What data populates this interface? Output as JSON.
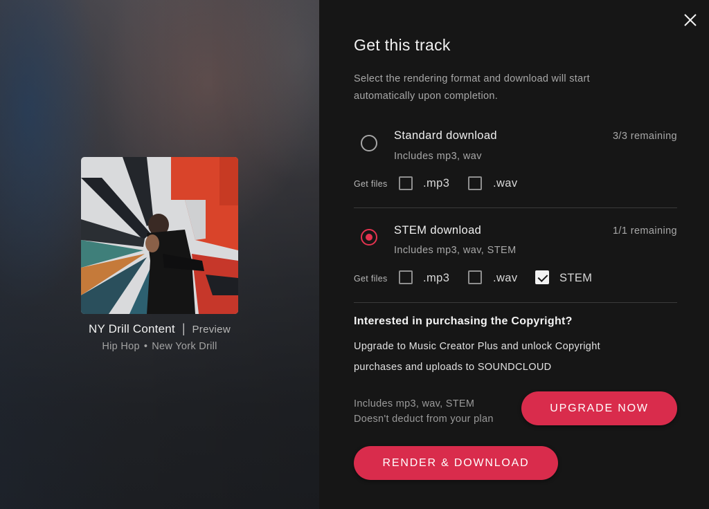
{
  "track": {
    "title": "NY Drill Content",
    "separator": "|",
    "preview_label": "Preview",
    "genres": [
      "Hip Hop",
      "New York Drill"
    ],
    "genre_separator": "•"
  },
  "panel": {
    "heading": "Get this track",
    "intro": "Select the rendering format and download will start automatically upon completion.",
    "close_icon": "close-icon"
  },
  "options": [
    {
      "title": "Standard download",
      "remaining": "3/3 remaining",
      "subtitle": "Includes mp3, wav",
      "selected": false,
      "get_files_label": "Get files",
      "files": [
        {
          "label": ".mp3",
          "checked": false
        },
        {
          "label": ".wav",
          "checked": false
        }
      ]
    },
    {
      "title": "STEM download",
      "remaining": "1/1 remaining",
      "subtitle": "Includes mp3, wav, STEM",
      "selected": true,
      "get_files_label": "Get files",
      "files": [
        {
          "label": ".mp3",
          "checked": false
        },
        {
          "label": ".wav",
          "checked": false
        },
        {
          "label": "STEM",
          "checked": true
        }
      ]
    }
  ],
  "copyright": {
    "title": "Interested in purchasing the Copyright?",
    "body": "Upgrade to Music Creator Plus and unlock Copyright purchases and uploads to SOUNDCLOUD"
  },
  "upgrade": {
    "note_line1": "Includes mp3, wav, STEM",
    "note_line2": "Doesn't deduct from your plan",
    "button": "UPGRADE NOW"
  },
  "render_button": "RENDER & DOWNLOAD",
  "colors": {
    "accent": "#d92c4c",
    "radio_selected": "#e4334f",
    "panel_bg": "#161616"
  }
}
